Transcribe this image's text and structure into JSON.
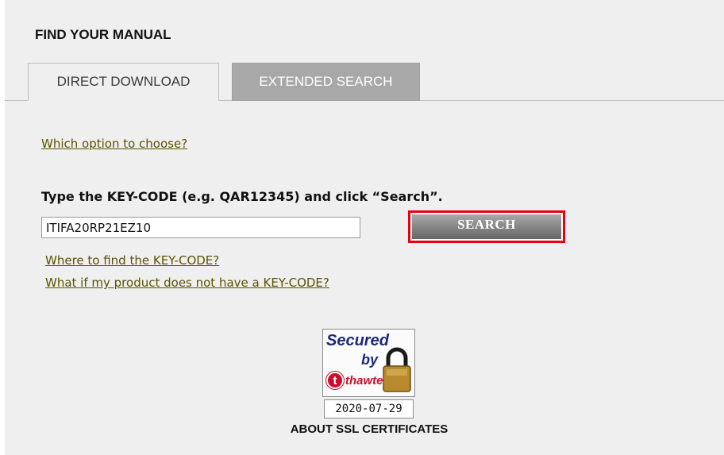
{
  "header": {
    "title": "FIND YOUR MANUAL"
  },
  "tabs": {
    "direct": {
      "label": "DIRECT DOWNLOAD"
    },
    "extended": {
      "label": "EXTENDED SEARCH"
    }
  },
  "links": {
    "which_option": "Which option to choose?",
    "where_keycode": "Where to find the KEY-CODE?",
    "no_keycode": "What if my product does not have a KEY-CODE?"
  },
  "search": {
    "instruction": "Type the KEY-CODE (e.g. QAR12345) and click “Search”.",
    "keycode_value": "ITIFA20RP21EZ10",
    "button_label": "SEARCH"
  },
  "ssl": {
    "badge_line1": "Secured",
    "badge_line2": "by",
    "badge_brand": "thawte",
    "badge_brand_mark": "t",
    "date": "2020-07-29",
    "caption": "ABOUT SSL CERTIFICATES",
    "lock_icon": "padlock-icon"
  },
  "colors": {
    "panel_bg": "#efefef",
    "link": "#5a5300",
    "button_highlight": "#e8000b",
    "inactive_tab": "#a8a8a8",
    "thawte_red": "#c8102e",
    "badge_blue": "#1e2a7a"
  }
}
